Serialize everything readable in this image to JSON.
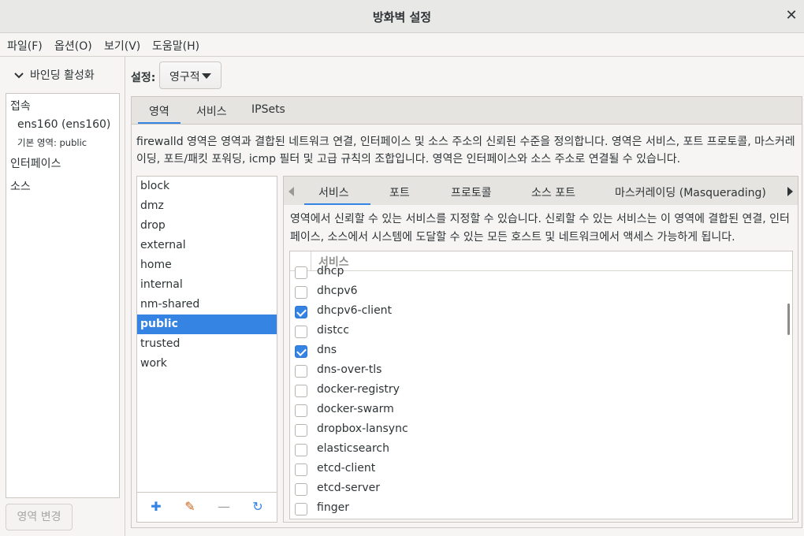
{
  "window": {
    "title": "방화벽 설정",
    "close_glyph": "✕"
  },
  "menu": [
    {
      "label": "파일(F)"
    },
    {
      "label": "옵션(O)"
    },
    {
      "label": "보기(V)"
    },
    {
      "label": "도움말(H)"
    }
  ],
  "sidebar": {
    "binding_toggle": "바인딩 활성화",
    "connection_header": "접속",
    "connection_name": "ens160 (ens160)",
    "default_zone": "기본 영역: public",
    "interfaces_header": "인터페이스",
    "sources_header": "소스",
    "change_zone_button": "영역 변경"
  },
  "configuration": {
    "label": "설정:",
    "value": "영구적"
  },
  "main_tabs": [
    {
      "label": "영역",
      "active": true
    },
    {
      "label": "서비스",
      "active": false
    },
    {
      "label": "IPSets",
      "active": false
    }
  ],
  "zone_description": [
    "firewalld 영역은 영역과 결합된 네트워크 연결, 인터페이스 및 소스 주소의 신뢰된 수준을 정의합니다. 영역은 서비스, 포트 프로토콜, 마스커레",
    "이딩, 포트/패킷 포워딩, icmp 필터 및 고급 규칙의 조합입니다. 영역은 인터페이스와 소스 주소로 연결될 수 있습니다."
  ],
  "zones": [
    {
      "name": "block",
      "selected": false
    },
    {
      "name": "dmz",
      "selected": false
    },
    {
      "name": "drop",
      "selected": false
    },
    {
      "name": "external",
      "selected": false
    },
    {
      "name": "home",
      "selected": false
    },
    {
      "name": "internal",
      "selected": false
    },
    {
      "name": "nm-shared",
      "selected": false
    },
    {
      "name": "public",
      "selected": true
    },
    {
      "name": "trusted",
      "selected": false
    },
    {
      "name": "work",
      "selected": false
    }
  ],
  "zone_tools": [
    {
      "icon": "add-icon",
      "glyph": "✚",
      "color": "#3584e4"
    },
    {
      "icon": "edit-icon",
      "glyph": "✎",
      "color": "#c9651b"
    },
    {
      "icon": "remove-icon",
      "glyph": "—",
      "color": "#9a9996"
    },
    {
      "icon": "load-defaults-icon",
      "glyph": "↻",
      "color": "#3584e4"
    }
  ],
  "sub_tabs": [
    {
      "label": "서비스",
      "active": true
    },
    {
      "label": "포트",
      "active": false
    },
    {
      "label": "프로토콜",
      "active": false
    },
    {
      "label": "소스 포트",
      "active": false
    },
    {
      "label": "마스커레이딩 (Masquerading)",
      "active": false
    }
  ],
  "services_description": [
    "영역에서 신뢰할 수 있는 서비스를 지정할 수 있습니다. 신뢰할 수 있는 서비스는 이 영역에 결합된 연결, 인터",
    "페이스, 소스에서 시스템에 도달할 수 있는 모든 호스트 및 네트워크에서 액세스 가능하게 됩니다."
  ],
  "services_column_header": "서비스",
  "services": [
    {
      "name": "dhcp",
      "checked": false
    },
    {
      "name": "dhcpv6",
      "checked": false
    },
    {
      "name": "dhcpv6-client",
      "checked": true
    },
    {
      "name": "distcc",
      "checked": false
    },
    {
      "name": "dns",
      "checked": true
    },
    {
      "name": "dns-over-tls",
      "checked": false
    },
    {
      "name": "docker-registry",
      "checked": false
    },
    {
      "name": "docker-swarm",
      "checked": false
    },
    {
      "name": "dropbox-lansync",
      "checked": false
    },
    {
      "name": "elasticsearch",
      "checked": false
    },
    {
      "name": "etcd-client",
      "checked": false
    },
    {
      "name": "etcd-server",
      "checked": false
    },
    {
      "name": "finger",
      "checked": false
    }
  ],
  "colors": {
    "accent": "#3584e4",
    "window_bg": "#f6f5f4",
    "text": "#2e3436"
  }
}
